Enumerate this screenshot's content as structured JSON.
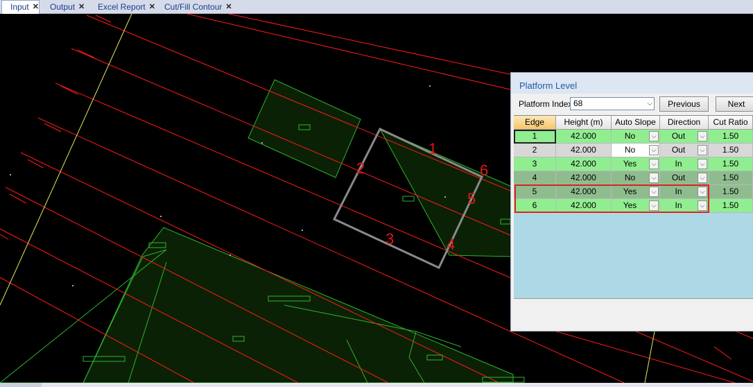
{
  "tabs": [
    {
      "label": "Input",
      "active": true
    },
    {
      "label": "Output",
      "active": false
    },
    {
      "label": "Excel Report",
      "active": false
    },
    {
      "label": "Cut/Fill Contour",
      "active": false
    }
  ],
  "drawing": {
    "platform_labels": [
      "1",
      "2",
      "3",
      "4",
      "5",
      "6"
    ],
    "line_color": "#ff1010",
    "lot_color": "#22c022"
  },
  "dialog": {
    "title": "Platform Level",
    "platform_index_label": "Platform Index",
    "platform_index_value": "68",
    "previous_label": "Previous",
    "next_label": "Next",
    "columns": [
      "Edge",
      "Height (m)",
      "Auto Slope",
      "Direction",
      "Cut Ratio"
    ],
    "rows": [
      {
        "edge": "1",
        "height": "42.000",
        "auto_slope": "No",
        "direction": "Out",
        "cut_ratio": "1.50",
        "color": "#90ee90"
      },
      {
        "edge": "2",
        "height": "42.000",
        "auto_slope": "No",
        "direction": "Out",
        "cut_ratio": "1.50",
        "color": "#d8d8d8"
      },
      {
        "edge": "3",
        "height": "42.000",
        "auto_slope": "Yes",
        "direction": "In",
        "cut_ratio": "1.50",
        "color": "#90ee90"
      },
      {
        "edge": "4",
        "height": "42.000",
        "auto_slope": "No",
        "direction": "Out",
        "cut_ratio": "1.50",
        "color": "#8fbc8f"
      },
      {
        "edge": "5",
        "height": "42.000",
        "auto_slope": "Yes",
        "direction": "In",
        "cut_ratio": "1.50",
        "color": "#8fbc8f"
      },
      {
        "edge": "6",
        "height": "42.000",
        "auto_slope": "Yes",
        "direction": "In",
        "cut_ratio": "1.50",
        "color": "#90ee90"
      }
    ],
    "highlight_color": "#e02020"
  }
}
